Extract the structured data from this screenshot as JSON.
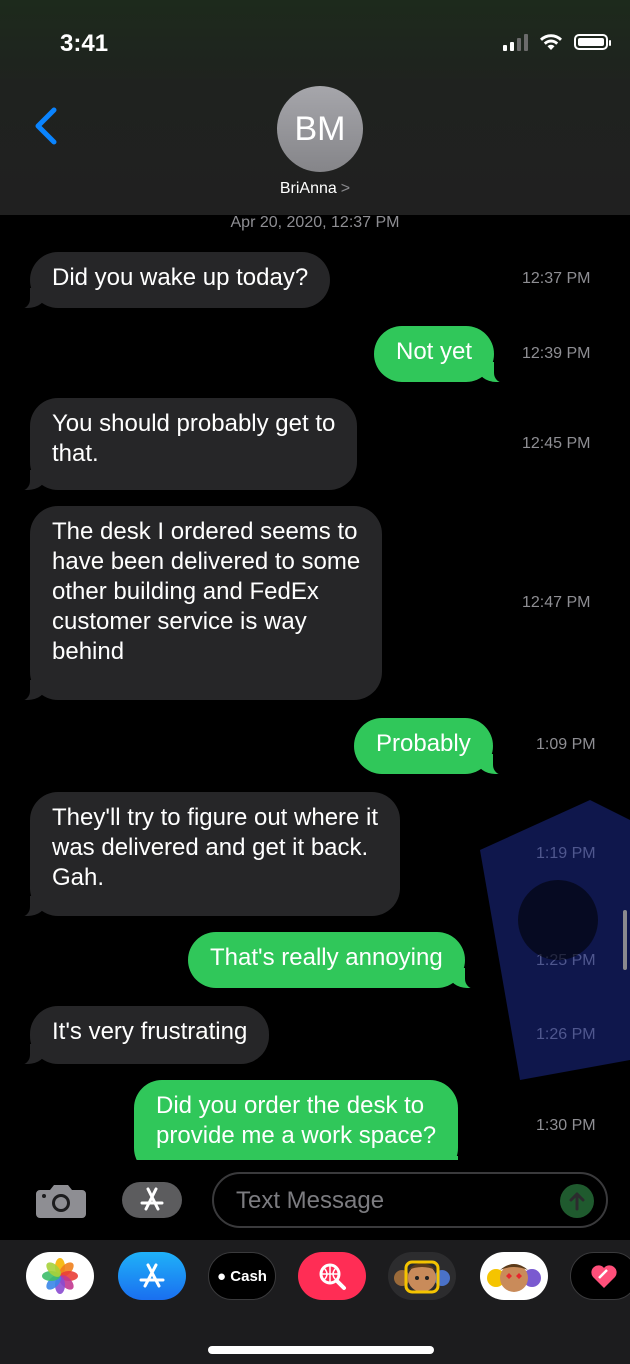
{
  "status_bar": {
    "time": "3:41"
  },
  "header": {
    "avatar_initials": "BM",
    "contact_name": "BriAnna",
    "contact_chevron": ">"
  },
  "transcript": {
    "date_header": "Apr 20, 2020, 12:37 PM",
    "messages": [
      {
        "direction": "incoming",
        "text": "Did you wake up today?",
        "time": "12:37 PM"
      },
      {
        "direction": "outgoing",
        "text": "Not yet",
        "time": "12:39 PM"
      },
      {
        "direction": "incoming",
        "lines": [
          "You should probably get to",
          "that."
        ],
        "time": "12:45 PM"
      },
      {
        "direction": "incoming",
        "lines": [
          "The desk I ordered seems to",
          "have been delivered to some",
          "other building and FedEx",
          "customer service is way",
          "behind"
        ],
        "time": "12:47 PM"
      },
      {
        "direction": "outgoing",
        "text": "Probably",
        "time": "1:09 PM"
      },
      {
        "direction": "incoming",
        "lines": [
          "They'll try to figure out where it",
          "was delivered and get it back.",
          "Gah."
        ],
        "time": "1:19 PM"
      },
      {
        "direction": "outgoing",
        "text": "That's really annoying",
        "time": "1:25 PM"
      },
      {
        "direction": "incoming",
        "text": "It's very frustrating",
        "time": "1:26 PM"
      },
      {
        "direction": "outgoing",
        "lines": [
          "Did you order the desk to",
          "provide me a work space?"
        ],
        "time": "1:30 PM"
      }
    ]
  },
  "composer": {
    "placeholder": "Text Message"
  },
  "app_drawer": {
    "apps": [
      {
        "name": "photos",
        "icon": "photos-flower-icon"
      },
      {
        "name": "app-store",
        "icon": "app-store-icon"
      },
      {
        "name": "apple-cash",
        "label": "Cash",
        "icon": "apple-cash-icon"
      },
      {
        "name": "images-search",
        "icon": "globe-search-icon"
      },
      {
        "name": "memoji",
        "icon": "memoji-icon"
      },
      {
        "name": "memoji-stickers",
        "icon": "memoji-stickers-icon"
      },
      {
        "name": "digital-touch",
        "icon": "heart-icon"
      }
    ]
  },
  "colors": {
    "outgoing_bubble": "#30c75a",
    "incoming_bubble": "#262628",
    "accent_blue": "#0a84ff"
  }
}
